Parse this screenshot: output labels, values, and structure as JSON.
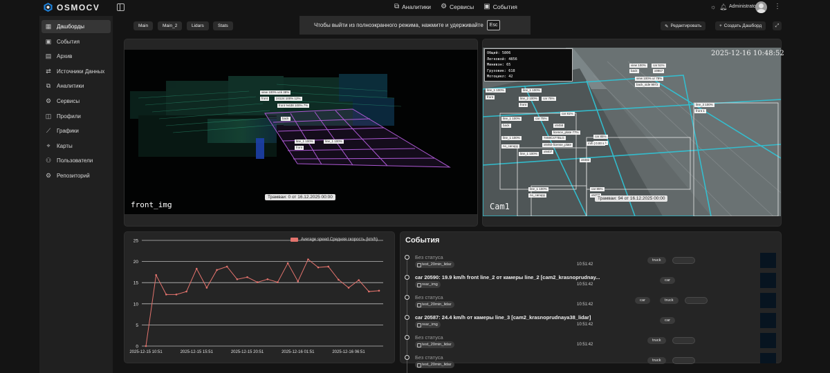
{
  "header": {
    "logo_text": "OSMOCV",
    "nav": [
      {
        "icon": "analytics-icon",
        "label": "Аналитики"
      },
      {
        "icon": "services-icon",
        "label": "Сервисы"
      },
      {
        "icon": "events-icon",
        "label": "События"
      }
    ],
    "username": "Administrator"
  },
  "sidebar": {
    "items": [
      {
        "label": "Дашборды",
        "icon": "dashboards-icon",
        "active": true
      },
      {
        "label": "События",
        "icon": "events-icon"
      },
      {
        "label": "Архив",
        "icon": "archive-icon"
      },
      {
        "label": "Источники Данных",
        "icon": "data-sources-icon"
      },
      {
        "label": "Аналитики",
        "icon": "analytics-icon"
      },
      {
        "label": "Сервисы",
        "icon": "services-icon"
      },
      {
        "label": "Профили",
        "icon": "profiles-icon"
      },
      {
        "label": "Графики",
        "icon": "graphs-icon"
      },
      {
        "label": "Карты",
        "icon": "maps-icon"
      },
      {
        "label": "Пользователи",
        "icon": "users-icon"
      },
      {
        "label": "Репозиторий",
        "icon": "repository-icon"
      }
    ]
  },
  "tabs": [
    "Main",
    "Main_2",
    "Lidars",
    "Stats"
  ],
  "fullscreen_banner": {
    "text": "Чтобы выйти из полноэкранного режима, нажмите и удерживайте",
    "key": "Esc"
  },
  "actions": {
    "edit": "Редактировать",
    "create": "Создать Дашборд"
  },
  "lidar_panel": {
    "name": "front_img",
    "caption": "Трамваи: 0 от 16.12.2025 00:00",
    "tags": [
      "view 100% uck 38%",
      "front",
      "24124 100% 12%",
      "front %638 100% 7%",
      "back",
      "line_1 100%",
      "front",
      "line_1 100%"
    ]
  },
  "camera_panel": {
    "name": "Cam1",
    "timestamp": "2025-12-16 10:48:52",
    "caption": "Трамваи: 94 от 16.12.2025 00:00",
    "stats": [
      "Общий: 5806",
      "Легковой: 4856",
      "Минивэн: 65",
      "Грузовик: 618",
      "Мотоцикл: 42"
    ],
    "tags": [
      "view 100%",
      "car 51%",
      "back",
      "x9967",
      "view 100% ur 78%",
      "back_side 9972",
      "line_1 100%",
      "line_1 100%",
      "front",
      "line_2 100%",
      "car 75%",
      "front",
      "line_1 100%",
      "car 75%",
      "line_3 100%",
      "front 1",
      "car 81%",
      "back",
      "x9458",
      "licence_plate 77%",
      "car 85%",
      "line_1 100%",
      "7e59C477BLG",
      "car 81%",
      "m/h | 0.00 s",
      "no_canopy",
      "x8492-license_plate",
      "x9407",
      "line_1 100%",
      "x8482",
      "line_1 100%",
      "car 85%",
      "no_canopy",
      "x9407"
    ]
  },
  "chart_data": {
    "type": "line",
    "title": "",
    "xlabel": "",
    "ylabel": "",
    "ylim": [
      0,
      25
    ],
    "yticks": [
      0,
      5,
      10,
      15,
      20,
      25
    ],
    "xticks": [
      "2025-12-15 10:51",
      "2025-12-15 15:51",
      "2025-12-15 20:51",
      "2025-12-16 01:51",
      "2025-12-16 06:51"
    ],
    "legend_position": "top-right",
    "series": [
      {
        "name": "Average speed Средняя скорость (km/h)",
        "color": "#e3736d",
        "values": [
          0,
          16.8,
          12.2,
          12.2,
          12.9,
          18.3,
          13.8,
          18,
          18.8,
          15.8,
          16.3,
          15.1,
          15.8,
          15.1,
          19.6,
          15.3,
          20.5,
          18.6,
          18.8,
          15.7,
          13.8,
          15.6,
          12.9,
          13.1
        ]
      }
    ]
  },
  "events": {
    "title": "События",
    "items": [
      {
        "title": "Без статуса",
        "muted": true,
        "source": "test_20min_lidar",
        "time": "10:51:42",
        "chips": [
          "truck",
          ""
        ]
      },
      {
        "title": "car 20590: 19.9 km/h front line_2 от камеры line_2 [cam2_krasnoprudnay...",
        "muted": false,
        "source": "rear_img",
        "time": "10:51:42",
        "chips": [
          "car"
        ]
      },
      {
        "title": "Без статуса",
        "muted": true,
        "source": "test_20min_lidar",
        "time": "10:51:42",
        "chips": [
          "car",
          "truck",
          ""
        ]
      },
      {
        "title": "car 20587: 24.4 km/h от камеры line_3 [cam2_krasnoprudnaya38_lidar]",
        "muted": false,
        "source": "rear_img",
        "time": "10:51:42",
        "chips": [
          "car"
        ]
      },
      {
        "title": "Без статуса",
        "muted": true,
        "source": "test_20min_lidar",
        "time": "10:51:42",
        "chips": [
          "truck",
          ""
        ]
      },
      {
        "title": "Без статуса",
        "muted": true,
        "source": "test_20min_lidar",
        "time": "",
        "chips": [
          "truck",
          ""
        ]
      }
    ]
  }
}
